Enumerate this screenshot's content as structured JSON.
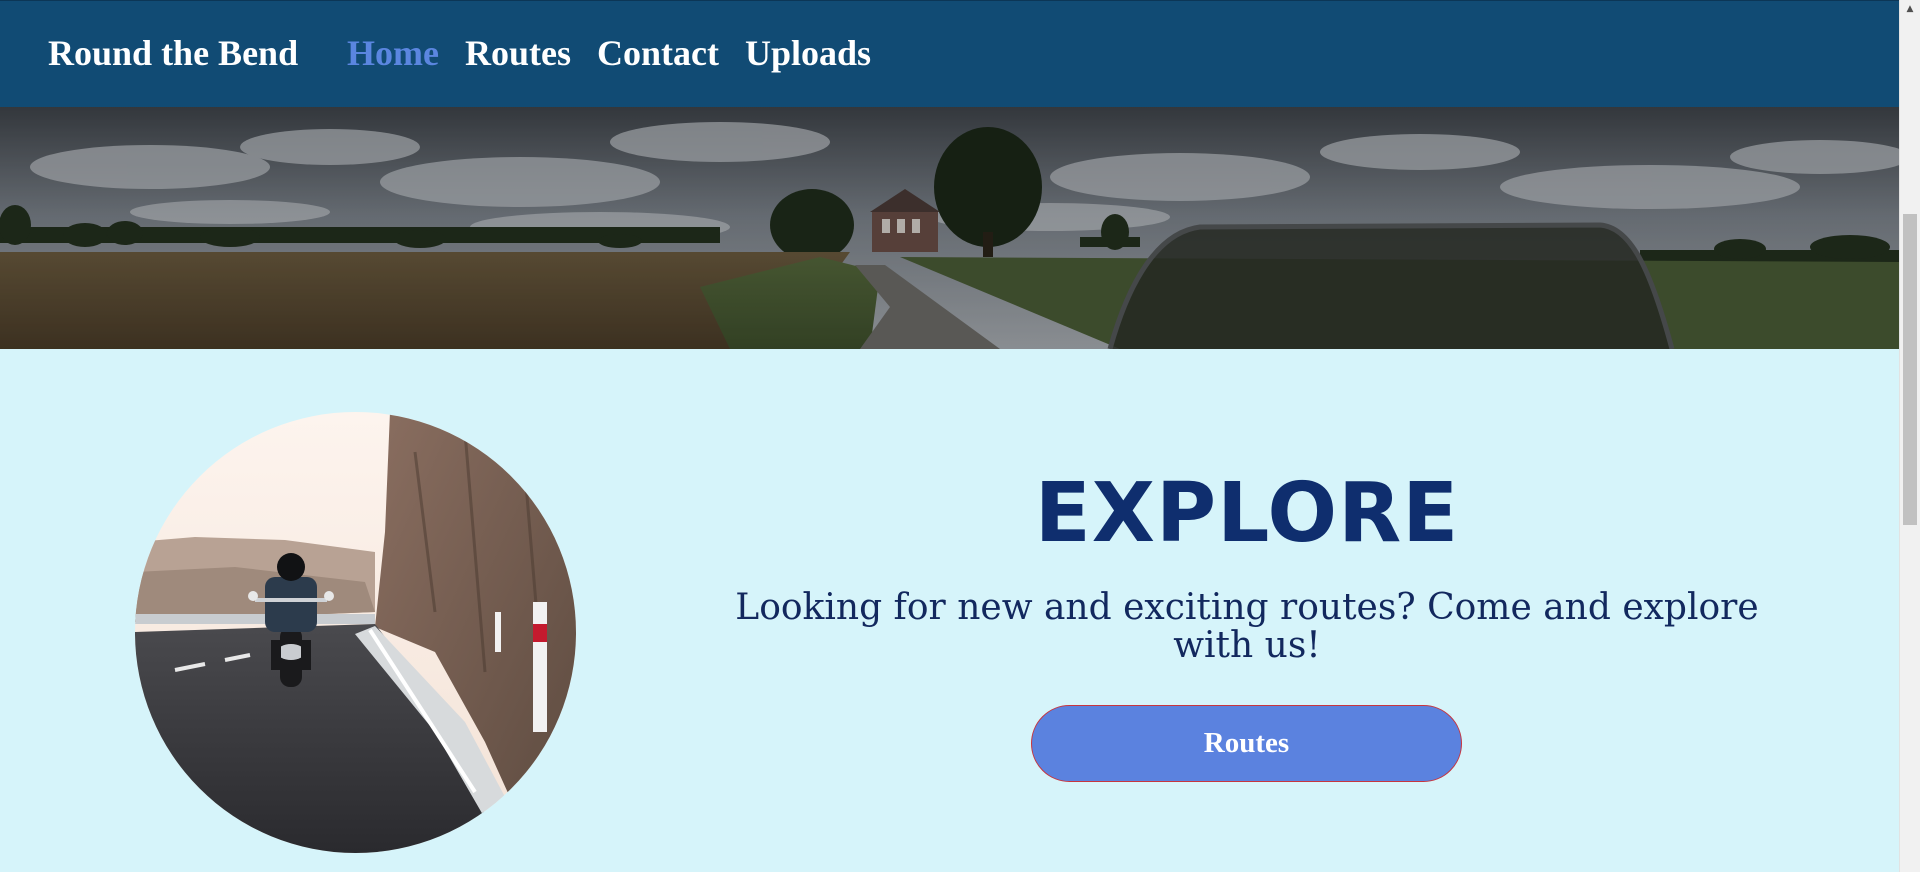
{
  "nav": {
    "brand": "Round the Bend",
    "links": [
      {
        "label": "Home",
        "active": true
      },
      {
        "label": "Routes",
        "active": false
      },
      {
        "label": "Contact",
        "active": false
      },
      {
        "label": "Uploads",
        "active": false
      }
    ]
  },
  "hero": {
    "image": "countryside-road-chapel-panorama"
  },
  "explore": {
    "image": "motorcyclist-on-mountain-road",
    "heading": "EXPLORE",
    "subtitle": "Looking for new and exciting routes? Come and explore with us!",
    "button_label": "Routes"
  },
  "scrollbar": {
    "up_arrow": "scroll-up-arrow-icon"
  },
  "colors": {
    "nav_background": "#114b74",
    "nav_active": "#5b86e0",
    "page_background": "#d6f4fa",
    "heading": "#0f2e6e",
    "button": "#5b82df",
    "button_border": "#c7353e"
  }
}
